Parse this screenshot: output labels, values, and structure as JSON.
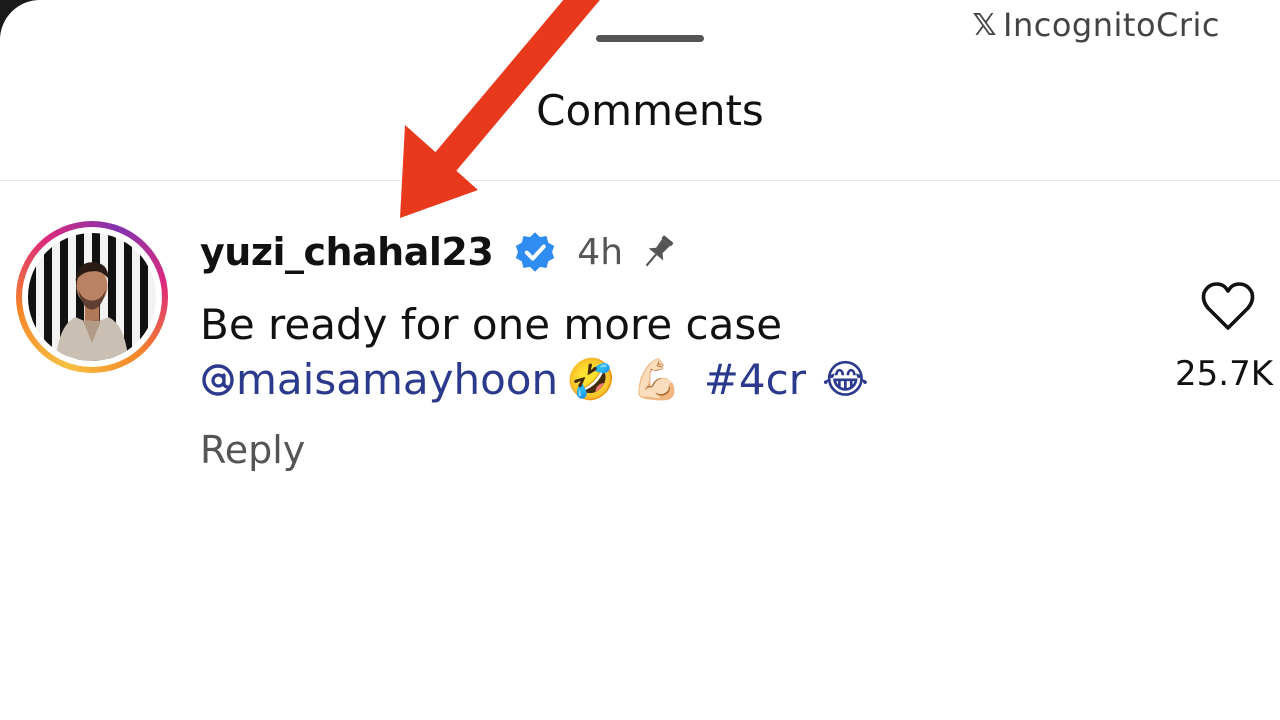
{
  "watermark": {
    "icon": "x-logo-icon",
    "text": "IncognitoCric"
  },
  "sheet": {
    "title": "Comments"
  },
  "comment": {
    "username": "yuzi_chahal23",
    "verified_icon": "verified-badge-icon",
    "time": "4h",
    "pin_icon": "pin-icon",
    "text_line1": "Be ready for one more case",
    "mention_icon": "threads-at-icon",
    "mention": "maisamayhoon",
    "emoji1": "🤣",
    "emoji2": "💪🏻",
    "hashtag": "#4cr",
    "emoji3": "😂",
    "reply_label": "Reply",
    "like_icon": "heart-outline-icon",
    "like_count": "25.7K"
  },
  "colors": {
    "annotation_arrow": "#e8391d",
    "verified_blue": "#2f8cf0",
    "mention_blue": "#2b3a8c"
  }
}
